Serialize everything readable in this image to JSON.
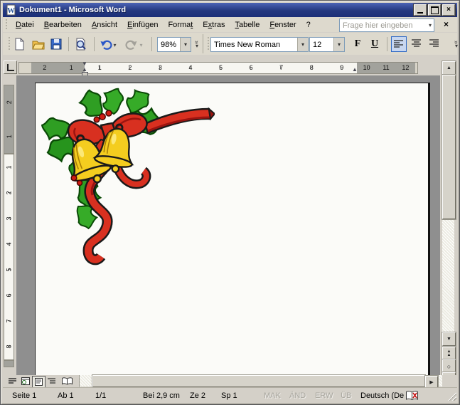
{
  "window": {
    "title": "Dokument1 - Microsoft Word",
    "close_glyph": "×"
  },
  "menu": {
    "items": [
      {
        "pre": "",
        "key": "D",
        "post": "atei"
      },
      {
        "pre": "",
        "key": "B",
        "post": "earbeiten"
      },
      {
        "pre": "",
        "key": "A",
        "post": "nsicht"
      },
      {
        "pre": "",
        "key": "E",
        "post": "infügen"
      },
      {
        "pre": "Forma",
        "key": "t",
        "post": ""
      },
      {
        "pre": "E",
        "key": "x",
        "post": "tras"
      },
      {
        "pre": "",
        "key": "T",
        "post": "abelle"
      },
      {
        "pre": "",
        "key": "F",
        "post": "enster"
      },
      {
        "pre": "?",
        "key": "",
        "post": ""
      }
    ],
    "question_placeholder": "Frage hier eingeben",
    "dropdown_glyph": "▾",
    "close_glyph": "×"
  },
  "standard_toolbar": {
    "zoom_value": "98%",
    "dropdown_glyph": "▾",
    "chevron_top": "»",
    "chevron_bottom": "▾"
  },
  "formatting_toolbar": {
    "font_name": "Times New Roman",
    "font_size": "12",
    "bold_label": "F",
    "underline_label": "U",
    "dropdown_glyph": "▾",
    "chevron_top": "»",
    "chevron_bottom": "▾"
  },
  "ruler": {
    "h_margin_left": [
      "2",
      "1"
    ],
    "h_main": [
      "1",
      "2",
      "3",
      "4",
      "5",
      "6",
      "7",
      "8",
      "9"
    ],
    "h_margin_right": [
      "10",
      "11",
      "12"
    ],
    "v_margin_top": [
      "2",
      "1"
    ],
    "v_main": [
      "1",
      "2",
      "3",
      "4",
      "5",
      "6",
      "7",
      "8"
    ]
  },
  "scrollbars": {
    "up_glyph": "▲",
    "down_glyph": "▼",
    "left_glyph": "◀",
    "right_glyph": "▶",
    "browse_prev_glyph": "▲",
    "browse_select_glyph": "○",
    "browse_next_glyph": "▼"
  },
  "status_bar": {
    "page": "Seite 1",
    "section": "Ab 1",
    "page_of": "1/1",
    "position": "Bei 2,9 cm",
    "line": "Ze 2",
    "column": "Sp 1",
    "indicators": [
      "MAK",
      "ÄND",
      "ERW",
      "ÜB"
    ],
    "language": "Deutsch (De"
  },
  "document": {
    "clipart_description": "christmas-bells-holly-ribbon-corner-decoration"
  },
  "colors": {
    "titlebar_blue": "#24387f",
    "toolbar_bg": "#ddd9cd",
    "workspace_gray": "#8f8f8f",
    "selection_border": "#316ac5",
    "selection_bg": "#c8d7f0",
    "ribbon_red": "#d83020",
    "holly_green": "#2f9e23",
    "bell_gold": "#f4cd1f"
  }
}
